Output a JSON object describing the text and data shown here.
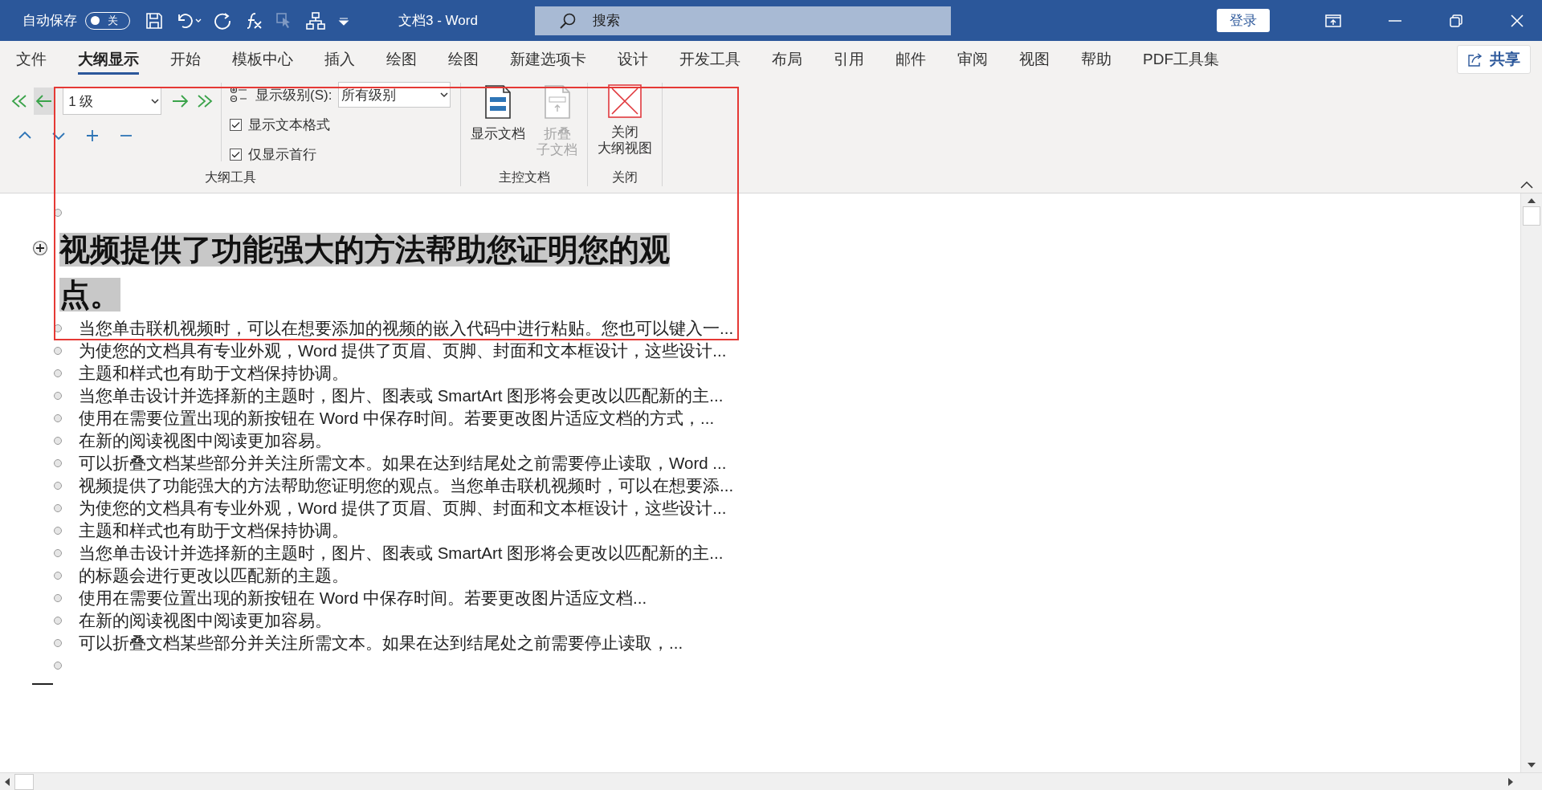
{
  "title_bar": {
    "autosave": {
      "label": "自动保存",
      "on": false,
      "state_text": "关"
    },
    "document_title": "文档3  -  Word",
    "search": {
      "placeholder": "搜索"
    },
    "sign_in": "登录"
  },
  "tabs": [
    {
      "label": "文件",
      "selected": false
    },
    {
      "label": "大纲显示",
      "selected": true
    },
    {
      "label": "开始",
      "selected": false
    },
    {
      "label": "模板中心",
      "selected": false
    },
    {
      "label": "插入",
      "selected": false
    },
    {
      "label": "绘图",
      "selected": false
    },
    {
      "label": "绘图",
      "selected": false
    },
    {
      "label": "新建选项卡",
      "selected": false
    },
    {
      "label": "设计",
      "selected": false
    },
    {
      "label": "开发工具",
      "selected": false
    },
    {
      "label": "布局",
      "selected": false
    },
    {
      "label": "引用",
      "selected": false
    },
    {
      "label": "邮件",
      "selected": false
    },
    {
      "label": "审阅",
      "selected": false
    },
    {
      "label": "视图",
      "selected": false
    },
    {
      "label": "帮助",
      "selected": false
    },
    {
      "label": "PDF工具集",
      "selected": false
    }
  ],
  "share": "共享",
  "ribbon": {
    "outline_tools": {
      "label": "大纲工具",
      "level_field": {
        "value": "1 级"
      },
      "show_level": {
        "label": "显示级别(S):",
        "value": "所有级别"
      },
      "checkboxes": [
        {
          "label": "显示文本格式",
          "checked": true
        },
        {
          "label": "仅显示首行",
          "checked": true
        }
      ]
    },
    "groups": [
      {
        "label": "主控文档",
        "buttons": [
          {
            "kind": "document",
            "label_lines": [
              "显示文档"
            ],
            "disabled": false
          },
          {
            "kind": "collapse",
            "label_lines": [
              "折叠",
              "子文档"
            ],
            "disabled": true
          }
        ]
      },
      {
        "label": "关闭",
        "buttons": [
          {
            "kind": "close",
            "label_lines": [
              "关闭",
              "大纲视图"
            ],
            "disabled": false
          }
        ]
      }
    ]
  },
  "outline": {
    "items": [
      {
        "kind": "empty"
      },
      {
        "kind": "heading",
        "text": "视频提供了功能强大的方法帮助您证明您的观点。",
        "selected": true,
        "children": [
          {
            "kind": "body",
            "text": "当您单击联机视频时，可以在想要添加的视频的嵌入代码中进行粘贴。您也可以键入一..."
          },
          {
            "kind": "body",
            "text": "为使您的文档具有专业外观，Word 提供了页眉、页脚、封面和文本框设计，这些设计..."
          },
          {
            "kind": "body",
            "text": "主题和样式也有助于文档保持协调。"
          },
          {
            "kind": "body",
            "text": "当您单击设计并选择新的主题时，图片、图表或 SmartArt 图形将会更改以匹配新的主..."
          },
          {
            "kind": "body",
            "text": "使用在需要位置出现的新按钮在 Word 中保存时间。若要更改图片适应文档的方式，..."
          },
          {
            "kind": "body",
            "text": "在新的阅读视图中阅读更加容易。"
          },
          {
            "kind": "body",
            "text": "可以折叠文档某些部分并关注所需文本。如果在达到结尾处之前需要停止读取，Word ..."
          },
          {
            "kind": "body",
            "text": "视频提供了功能强大的方法帮助您证明您的观点。当您单击联机视频时，可以在想要添..."
          },
          {
            "kind": "body",
            "text": "为使您的文档具有专业外观，Word 提供了页眉、页脚、封面和文本框设计，这些设计..."
          },
          {
            "kind": "body",
            "text": "主题和样式也有助于文档保持协调。"
          },
          {
            "kind": "body",
            "text": "当您单击设计并选择新的主题时，图片、图表或 SmartArt 图形将会更改以匹配新的主..."
          },
          {
            "kind": "body",
            "text": "的标题会进行更改以匹配新的主题。"
          },
          {
            "kind": "body",
            "text": "使用在需要位置出现的新按钮在 Word 中保存时间。若要更改图片适应文档..."
          },
          {
            "kind": "body",
            "text": "在新的阅读视图中阅读更加容易。"
          },
          {
            "kind": "body",
            "text": "可以折叠文档某些部分并关注所需文本。如果在达到结尾处之前需要停止读取，..."
          },
          {
            "kind": "empty"
          }
        ]
      }
    ]
  }
}
